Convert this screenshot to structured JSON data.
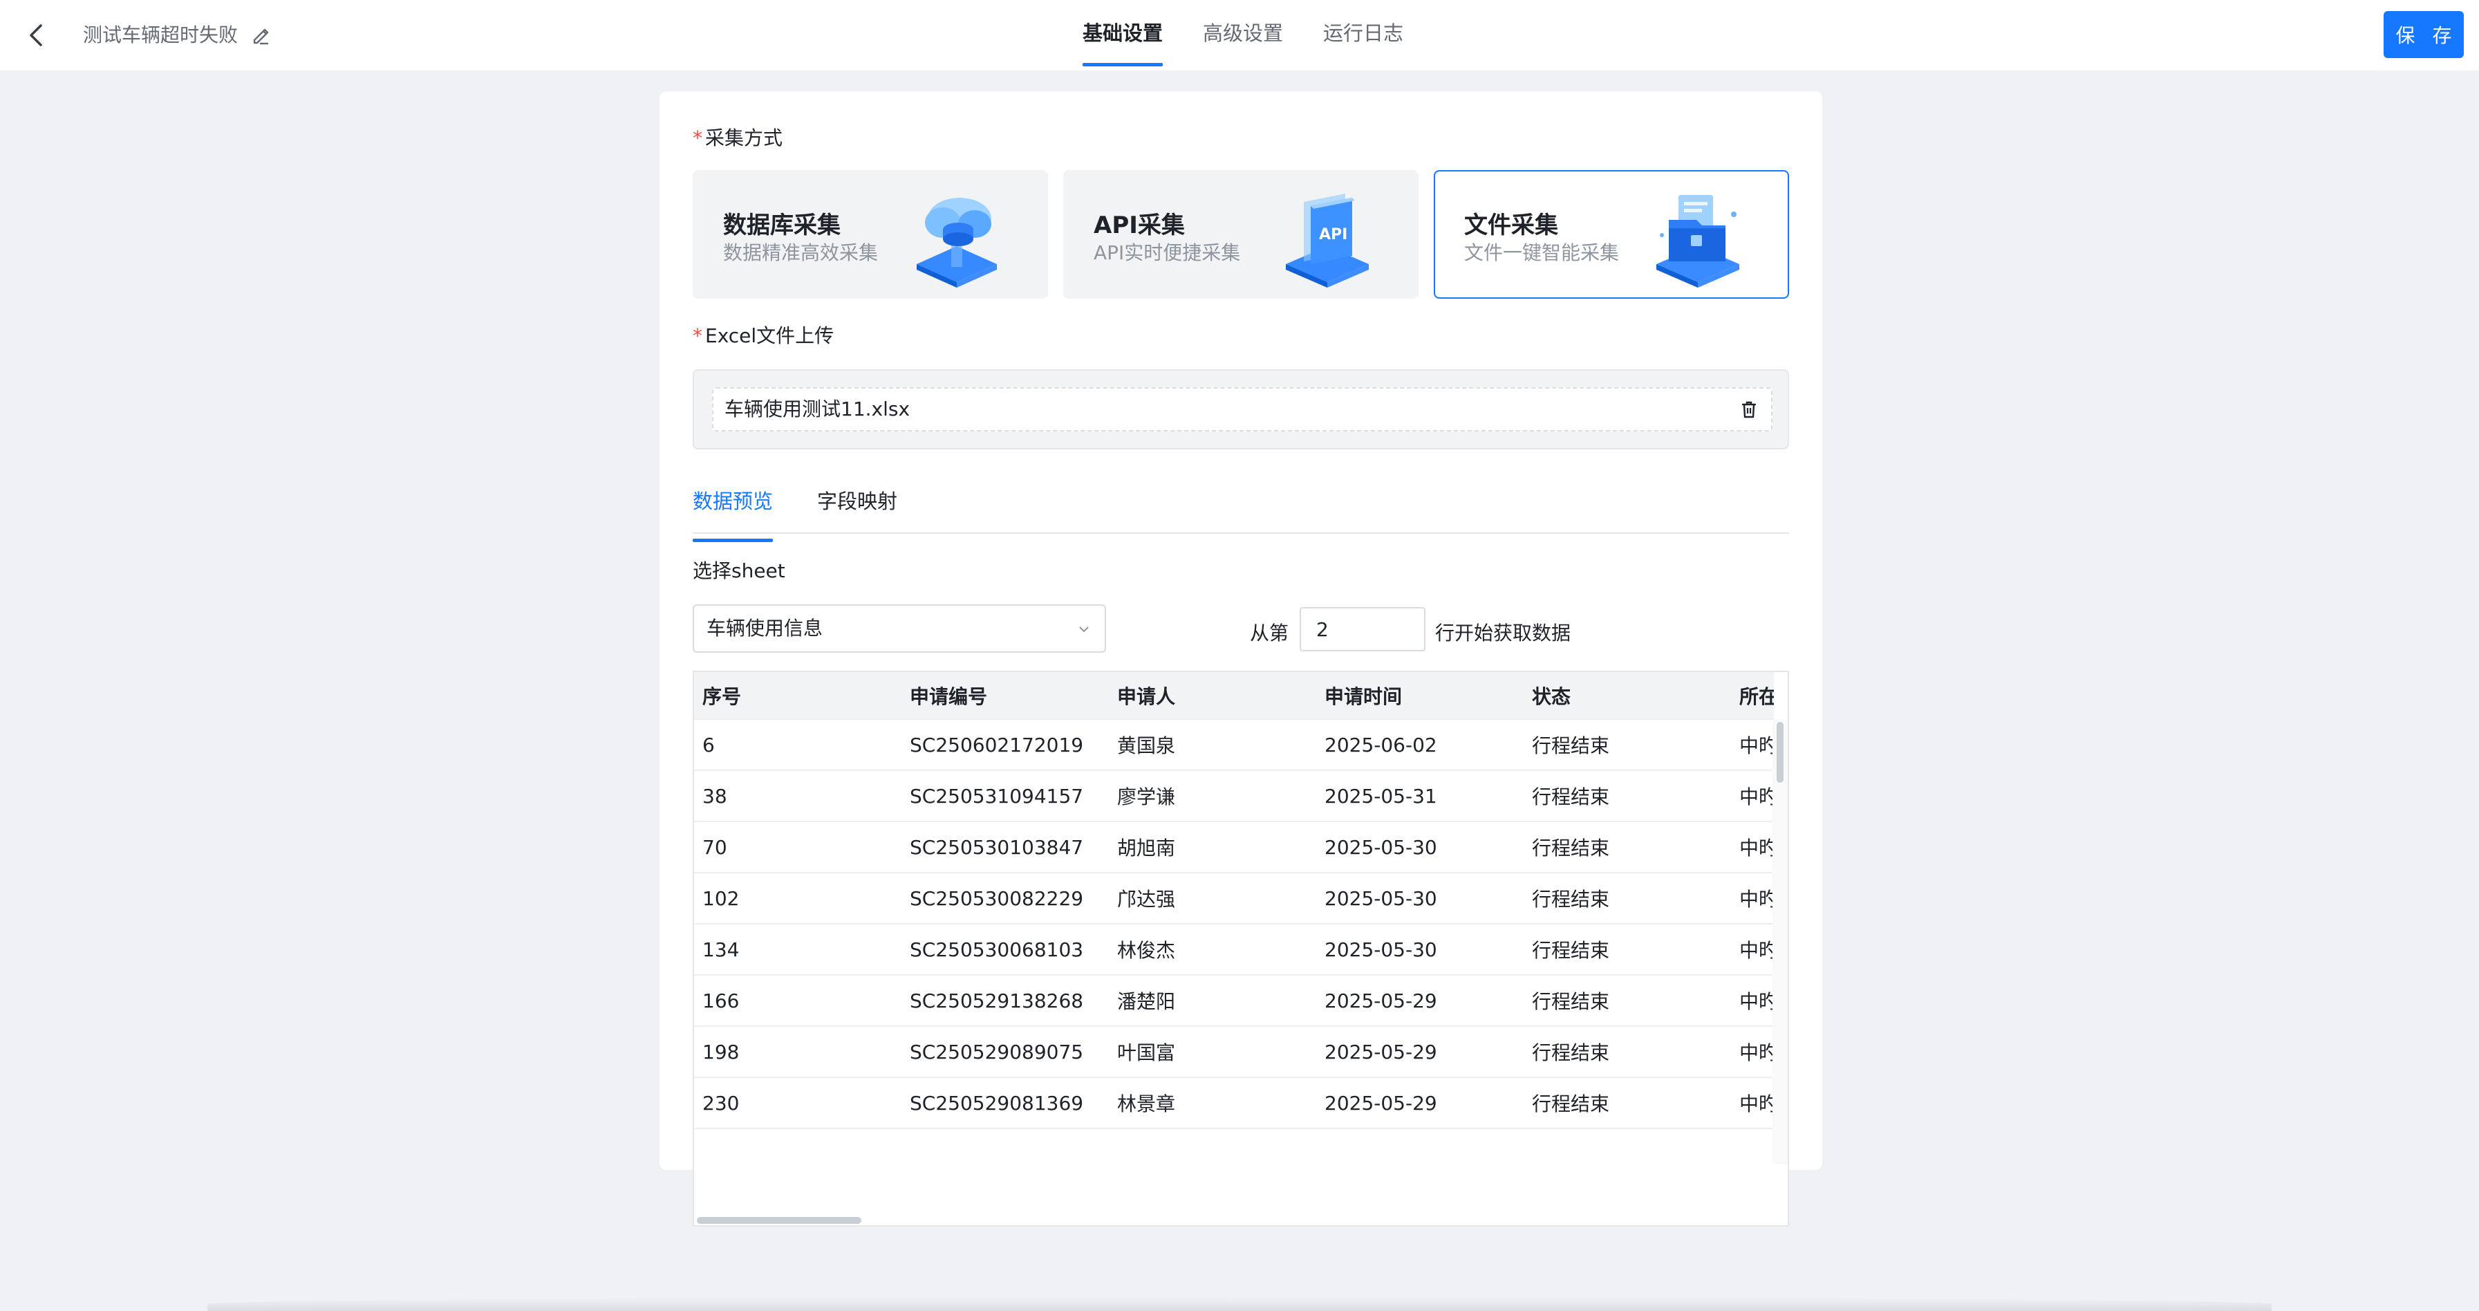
{
  "header": {
    "title": "测试车辆超时失败",
    "tabs": [
      {
        "label": "基础设置",
        "active": true
      },
      {
        "label": "高级设置",
        "active": false
      },
      {
        "label": "运行日志",
        "active": false
      }
    ],
    "save_label": "保 存",
    "accent_color": "#1677ff"
  },
  "form": {
    "method_label": "采集方式",
    "required_mark": "*",
    "methods": [
      {
        "title": "数据库采集",
        "subtitle": "数据精准高效采集",
        "icon": "database-cloud-icon",
        "selected": false
      },
      {
        "title": "API采集",
        "subtitle": "API实时便捷采集",
        "icon": "api-icon",
        "selected": false
      },
      {
        "title": "文件采集",
        "subtitle": "文件一键智能采集",
        "icon": "file-folder-icon",
        "selected": true
      }
    ],
    "upload_label": "Excel文件上传",
    "file_name": "车辆使用测试11.xlsx",
    "sub_tabs": [
      {
        "label": "数据预览",
        "active": true
      },
      {
        "label": "字段映射",
        "active": false
      }
    ],
    "sheet_label": "选择sheet",
    "sheet_value": "车辆使用信息",
    "row_prefix": "从第",
    "row_value": "2",
    "row_suffix": "行开始获取数据"
  },
  "table": {
    "columns": [
      "序号",
      "申请编号",
      "申请人",
      "申请时间",
      "状态",
      "所在组"
    ],
    "rows": [
      [
        "6",
        "SC250602172019",
        "黄国泉",
        "2025-06-02",
        "行程结束",
        "中旳"
      ],
      [
        "38",
        "SC250531094157",
        "廖学谦",
        "2025-05-31",
        "行程结束",
        "中旳"
      ],
      [
        "70",
        "SC250530103847",
        "胡旭南",
        "2025-05-30",
        "行程结束",
        "中旳"
      ],
      [
        "102",
        "SC250530082229",
        "邝达强",
        "2025-05-30",
        "行程结束",
        "中旳"
      ],
      [
        "134",
        "SC250530068103",
        "林俊杰",
        "2025-05-30",
        "行程结束",
        "中旳"
      ],
      [
        "166",
        "SC250529138268",
        "潘楚阳",
        "2025-05-29",
        "行程结束",
        "中旳"
      ],
      [
        "198",
        "SC250529089075",
        "叶国富",
        "2025-05-29",
        "行程结束",
        "中旳"
      ],
      [
        "230",
        "SC250529081369",
        "林景章",
        "2025-05-29",
        "行程结束",
        "中旳"
      ]
    ]
  }
}
